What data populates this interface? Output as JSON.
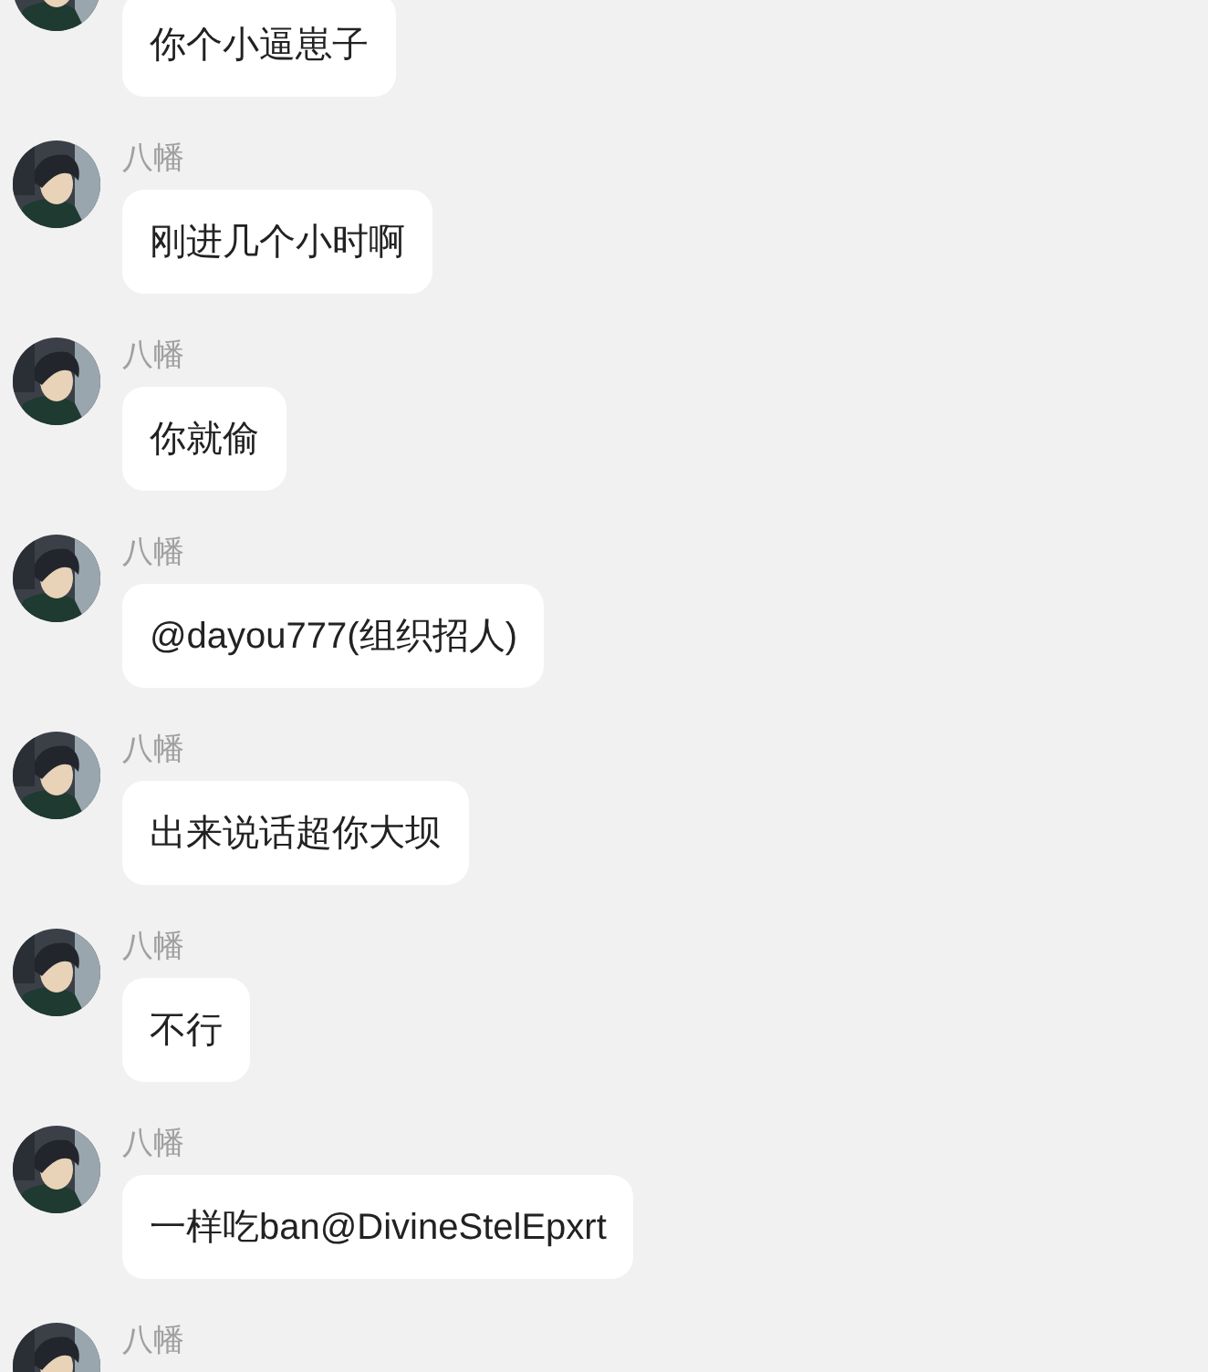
{
  "messages": [
    {
      "text": "你个小逼崽子"
    },
    {
      "sender": "八幡",
      "text": "刚进几个小时啊"
    },
    {
      "sender": "八幡",
      "text": "你就偷"
    },
    {
      "sender": "八幡",
      "text": "@dayou777(组织招人)"
    },
    {
      "sender": "八幡",
      "text": "出来说话超你大坝"
    },
    {
      "sender": "八幡",
      "text": "不行"
    },
    {
      "sender": "八幡",
      "text": "一样吃ban@DivineStelEpxrt"
    },
    {
      "sender": "八幡"
    }
  ]
}
